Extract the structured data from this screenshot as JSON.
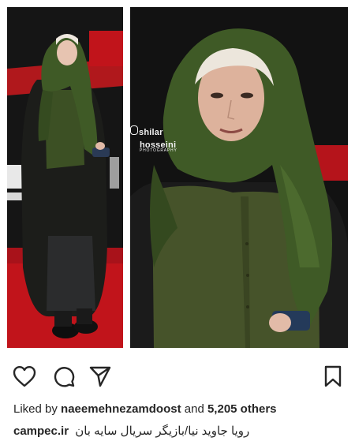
{
  "post": {
    "watermark": {
      "name": "shilar",
      "handle": "hosseini",
      "sub": "PHOTOGRAPHY"
    },
    "likes": {
      "prefix": "Liked by",
      "user": "naeemehnezamdoost",
      "joiner": "and",
      "count": "5,205 others"
    },
    "caption": {
      "author": "campec.ir",
      "text": "رویا جاوید نیا/بازیگر سریال سایه بان"
    },
    "icons": {
      "like": "heart-icon",
      "comment": "comment-bubble-icon",
      "share": "paper-plane-icon",
      "save": "bookmark-icon"
    },
    "colors": {
      "text": "#262626",
      "scarf_green": "#3f5a26",
      "carpet_red": "#c1141b",
      "backdrop": "#121212"
    }
  }
}
